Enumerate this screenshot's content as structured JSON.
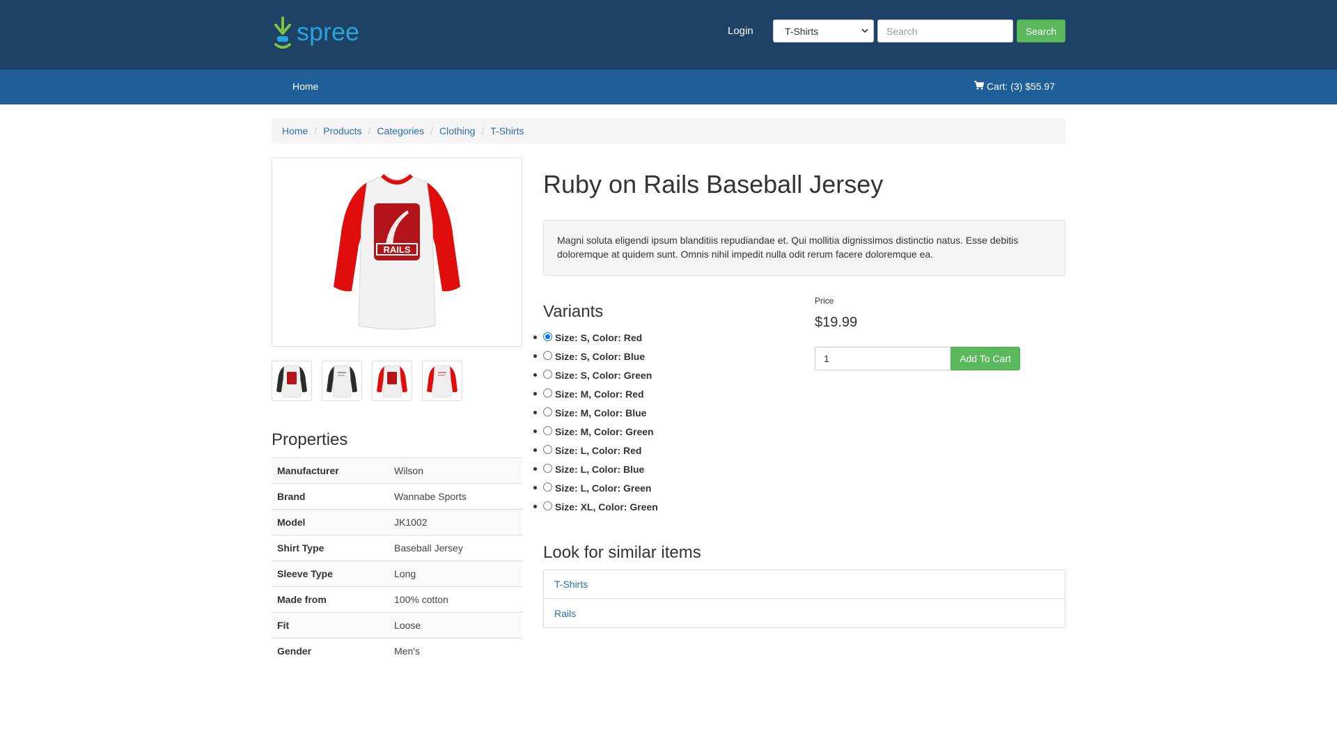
{
  "brand": {
    "name": "spree"
  },
  "header": {
    "login_label": "Login",
    "taxon_select": {
      "selected": "T-Shirts"
    },
    "search": {
      "placeholder": "Search",
      "value": "",
      "button_label": "Search"
    }
  },
  "nav": {
    "home_label": "Home",
    "cart_label": "Cart: (3) $55.97"
  },
  "breadcrumb": [
    "Home",
    "Products",
    "Categories",
    "Clothing",
    "T-Shirts"
  ],
  "product": {
    "title": "Ruby on Rails Baseball Jersey",
    "description": "Magni soluta eligendi ipsum blanditiis repudiandae et. Qui mollitia dignissimos distinctio natus. Esse debitis doloremque at quidem sunt. Omnis nihil impedit nulla odit rerum facere doloremque ea.",
    "image_text": "RAILS",
    "thumbnails": [
      {
        "name": "thumb-black-front"
      },
      {
        "name": "thumb-black-back"
      },
      {
        "name": "thumb-red-front"
      },
      {
        "name": "thumb-red-back"
      }
    ]
  },
  "properties": {
    "title": "Properties",
    "rows": [
      {
        "key": "Manufacturer",
        "value": "Wilson"
      },
      {
        "key": "Brand",
        "value": "Wannabe Sports"
      },
      {
        "key": "Model",
        "value": "JK1002"
      },
      {
        "key": "Shirt Type",
        "value": "Baseball Jersey"
      },
      {
        "key": "Sleeve Type",
        "value": "Long"
      },
      {
        "key": "Made from",
        "value": "100% cotton"
      },
      {
        "key": "Fit",
        "value": "Loose"
      },
      {
        "key": "Gender",
        "value": "Men's"
      }
    ]
  },
  "variants": {
    "title": "Variants",
    "items": [
      {
        "label": "Size: S, Color: Red",
        "selected": true
      },
      {
        "label": "Size: S, Color: Blue",
        "selected": false
      },
      {
        "label": "Size: S, Color: Green",
        "selected": false
      },
      {
        "label": "Size: M, Color: Red",
        "selected": false
      },
      {
        "label": "Size: M, Color: Blue",
        "selected": false
      },
      {
        "label": "Size: M, Color: Green",
        "selected": false
      },
      {
        "label": "Size: L, Color: Red",
        "selected": false
      },
      {
        "label": "Size: L, Color: Blue",
        "selected": false
      },
      {
        "label": "Size: L, Color: Green",
        "selected": false
      },
      {
        "label": "Size: XL, Color: Green",
        "selected": false
      }
    ]
  },
  "purchase": {
    "price_label": "Price",
    "price": "$19.99",
    "quantity": "1",
    "add_to_cart_label": "Add To Cart"
  },
  "similar": {
    "title": "Look for similar items",
    "items": [
      "T-Shirts",
      "Rails"
    ]
  },
  "colors": {
    "header_bg": "#1e4266",
    "nav_bg": "#1f5f99",
    "accent_green": "#5cb85c",
    "link_blue": "#2c6ea8",
    "brand_logo": "#2aa3db"
  },
  "icons": {
    "cart": "shopping-cart-icon",
    "logo": "spree-logo-icon",
    "select_chevron": "chevron-down-icon"
  }
}
